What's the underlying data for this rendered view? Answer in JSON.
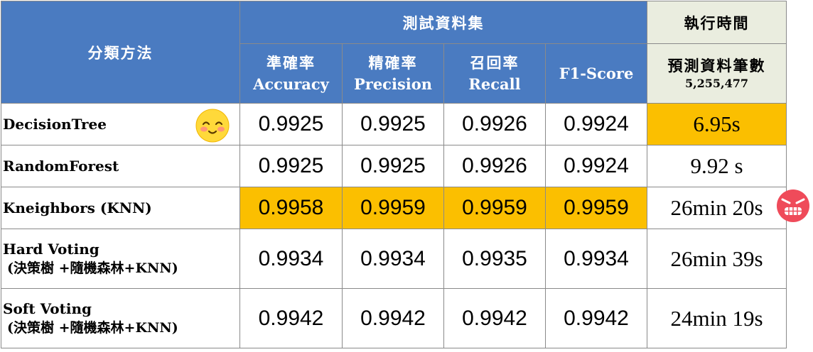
{
  "table": {
    "header": {
      "method": "分類方法",
      "test_set": "測試資料集",
      "exec_time": "執行時間",
      "columns": [
        {
          "zh": "準確率",
          "en": "Accuracy"
        },
        {
          "zh": "精確率",
          "en": "Precision"
        },
        {
          "zh": "召回率",
          "en": "Recall"
        },
        {
          "zh": "",
          "en": "F1-Score"
        }
      ],
      "count_label": "預測資料筆數",
      "count_value": "5,255,477"
    },
    "rows": [
      {
        "name": "DecisionTree",
        "sub": "",
        "values": [
          "0.9925",
          "0.9925",
          "0.9926",
          "0.9924"
        ],
        "time": "6.95s"
      },
      {
        "name": "RandomForest",
        "sub": "",
        "values": [
          "0.9925",
          "0.9925",
          "0.9926",
          "0.9924"
        ],
        "time": "9.92 s"
      },
      {
        "name": "Kneighbors (KNN)",
        "sub": "",
        "values": [
          "0.9958",
          "0.9959",
          "0.9959",
          "0.9959"
        ],
        "time": "26min 20s"
      },
      {
        "name": "Hard Voting",
        "sub": "(決策樹 +隨機森林+KNN)",
        "values": [
          "0.9934",
          "0.9934",
          "0.9935",
          "0.9934"
        ],
        "time": "26min 39s"
      },
      {
        "name": "Soft Voting",
        "sub": "(決策樹 +隨機森林+KNN)",
        "values": [
          "0.9942",
          "0.9942",
          "0.9942",
          "0.9942"
        ],
        "time": "24min 19s"
      }
    ]
  },
  "colors": {
    "header_blue": "#4a7bc1",
    "header_cream": "#eaeddf",
    "highlight": "#fbbf00"
  },
  "icons": {
    "happy": "smiling-face-icon",
    "angry": "angry-face-icon"
  }
}
